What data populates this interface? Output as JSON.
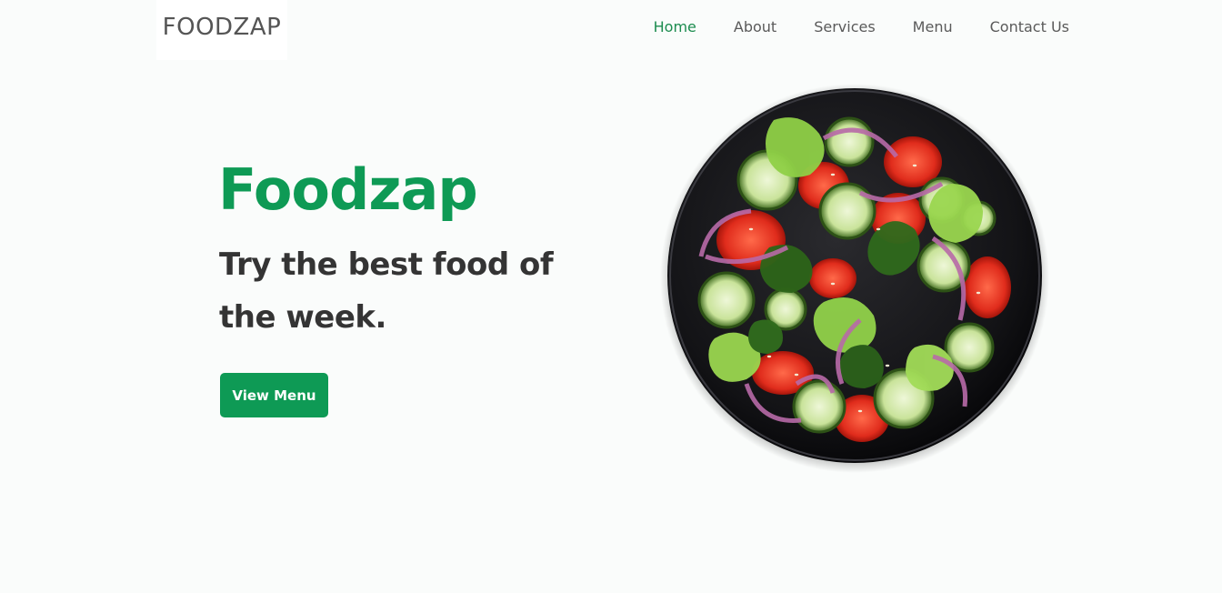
{
  "brand": {
    "logo": "FOODZAP"
  },
  "nav": {
    "items": [
      {
        "label": "Home",
        "active": true
      },
      {
        "label": "About"
      },
      {
        "label": "Services"
      },
      {
        "label": "Menu"
      },
      {
        "label": "Contact Us"
      }
    ]
  },
  "hero": {
    "title": "Foodzap",
    "subtitle": "Try the best food of the week.",
    "cta_label": "View Menu"
  },
  "colors": {
    "accent": "#0e9a55",
    "active_nav": "#1c8c4f",
    "text_dark": "#343434",
    "background": "#fafcfb"
  },
  "image": {
    "icon": "salad-bowl-photo"
  }
}
